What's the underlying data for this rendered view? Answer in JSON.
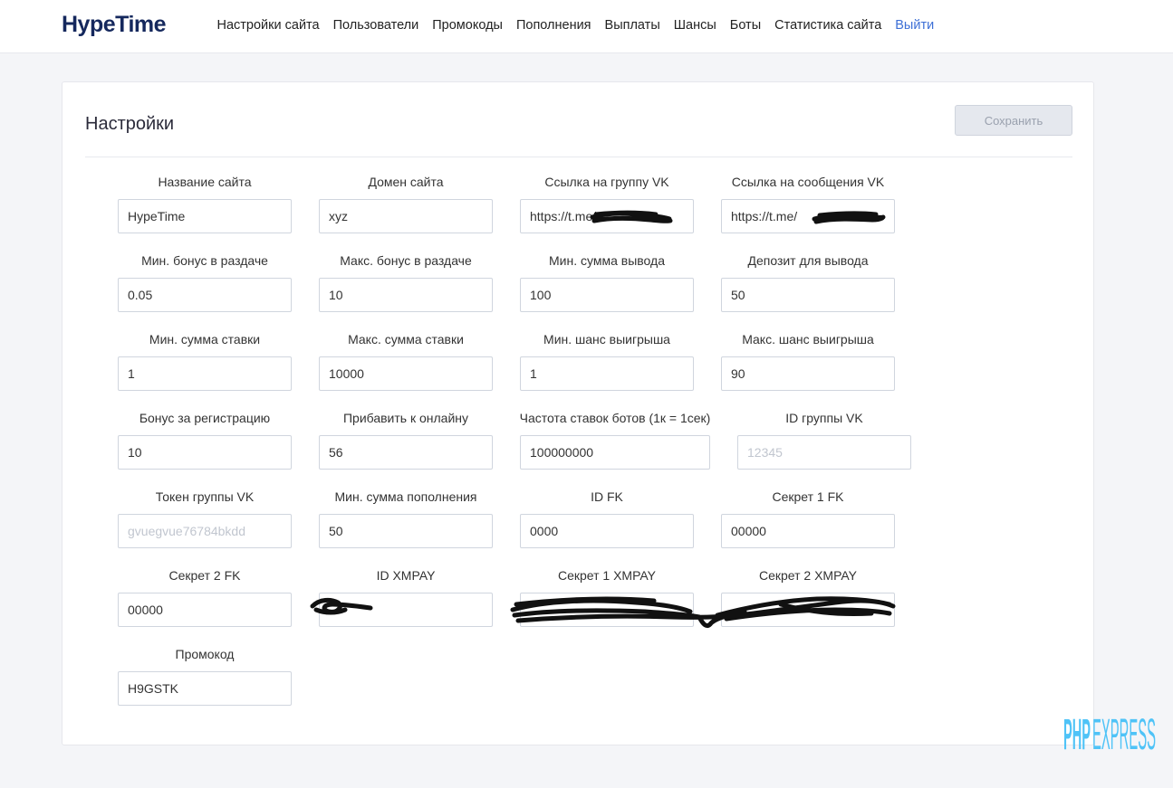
{
  "header": {
    "logo": "HypeTime",
    "nav": [
      {
        "label": "Настройки сайта"
      },
      {
        "label": "Пользователи"
      },
      {
        "label": "Промокоды"
      },
      {
        "label": "Пополнения"
      },
      {
        "label": "Выплаты"
      },
      {
        "label": "Шансы"
      },
      {
        "label": "Боты"
      },
      {
        "label": "Статистика сайта"
      }
    ],
    "exit_label": "Выйти",
    "exit_color": "#3d6fd6"
  },
  "settings": {
    "title": "Настройки",
    "save_label": "Сохранить",
    "fields": {
      "site_name": {
        "label": "Название сайта",
        "value": "HypeTime",
        "placeholder": ""
      },
      "domain": {
        "label": "Домен сайта",
        "value": "xyz",
        "placeholder": ""
      },
      "vk_group_link": {
        "label": "Ссылка на группу VK",
        "value": "https://t.me/",
        "placeholder": ""
      },
      "vk_messages_link": {
        "label": "Ссылка на сообщения VK",
        "value": "https://t.me/",
        "placeholder": ""
      },
      "min_bonus": {
        "label": "Мин. бонус в раздаче",
        "value": "0.05",
        "placeholder": ""
      },
      "max_bonus": {
        "label": "Макс. бонус в раздаче",
        "value": "10",
        "placeholder": ""
      },
      "min_withdraw": {
        "label": "Мин. сумма вывода",
        "value": "100",
        "placeholder": ""
      },
      "deposit_for_withdraw": {
        "label": "Депозит для вывода",
        "value": "50",
        "placeholder": ""
      },
      "min_bet": {
        "label": "Мин. сумма ставки",
        "value": "1",
        "placeholder": ""
      },
      "max_bet": {
        "label": "Макс. сумма ставки",
        "value": "10000",
        "placeholder": ""
      },
      "min_win_chance": {
        "label": "Мин. шанс выигрыша",
        "value": "1",
        "placeholder": ""
      },
      "max_win_chance": {
        "label": "Макс. шанс выигрыша",
        "value": "90",
        "placeholder": ""
      },
      "reg_bonus": {
        "label": "Бонус за регистрацию",
        "value": "10",
        "placeholder": ""
      },
      "online_add": {
        "label": "Прибавить к онлайну",
        "value": "56",
        "placeholder": ""
      },
      "bot_bet_rate": {
        "label": "Частота ставок ботов (1к = 1сек)",
        "value": "100000000",
        "placeholder": ""
      },
      "vk_group_id": {
        "label": "ID группы VK",
        "value": "",
        "placeholder": "12345"
      },
      "vk_group_token": {
        "label": "Токен группы VK",
        "value": "",
        "placeholder": "gvuegvue76784bkdd"
      },
      "min_deposit": {
        "label": "Мин. сумма пополнения",
        "value": "50",
        "placeholder": ""
      },
      "fk_id": {
        "label": "ID FK",
        "value": "0000",
        "placeholder": ""
      },
      "fk_secret1": {
        "label": "Секрет 1 FK",
        "value": "00000",
        "placeholder": ""
      },
      "fk_secret2": {
        "label": "Секрет 2 FK",
        "value": "00000",
        "placeholder": ""
      },
      "xmpay_id": {
        "label": "ID XMPAY",
        "value": "",
        "placeholder": ""
      },
      "xmpay_secret1": {
        "label": "Секрет 1 XMPAY",
        "value": "",
        "placeholder": ""
      },
      "xmpay_secret2": {
        "label": "Секрет 2 XMPAY",
        "value": "",
        "placeholder": ""
      },
      "promocode": {
        "label": "Промокод",
        "value": "H9GSTK",
        "placeholder": ""
      }
    }
  },
  "watermark": {
    "text_1": "PHP",
    "text_2": "EXPRESS",
    "color": "#4fc3f7"
  }
}
